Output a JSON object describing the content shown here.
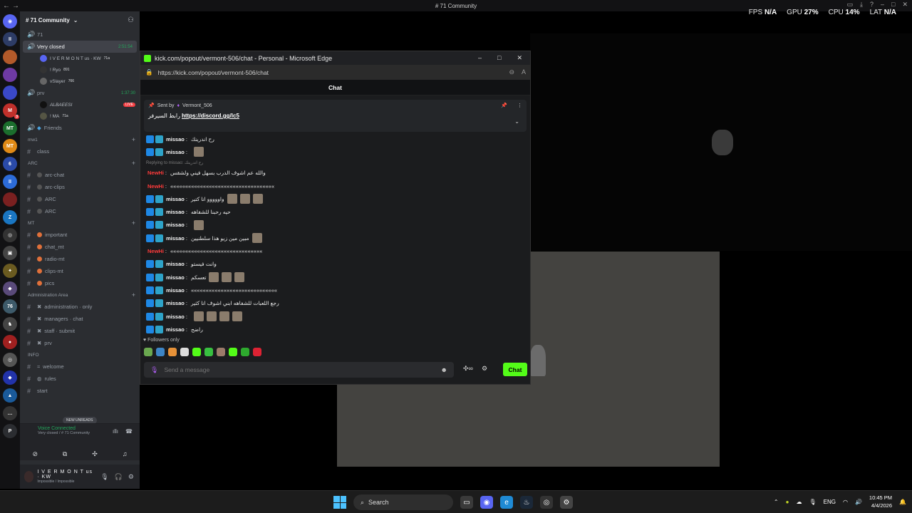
{
  "window": {
    "title": "# 71 Community",
    "nav_icons": "←→"
  },
  "overlay": {
    "fps_label": "FPS",
    "fps_value": "N/A",
    "gpu_label": "GPU",
    "gpu_value": "27%",
    "cpu_label": "CPU",
    "cpu_value": "14%",
    "lat_label": "LAT",
    "lat_value": "N/A"
  },
  "server": {
    "name": "# 71 Community"
  },
  "channels": {
    "top_voice": "71",
    "active": {
      "label": "Very closed",
      "time": "2:51:54"
    },
    "voice_users": [
      {
        "name": "I V E R M O N T us · KW",
        "tag": "71a"
      },
      {
        "name": "! Ryo",
        "tag": "891"
      },
      {
        "name": "vSlayer",
        "tag": "766"
      }
    ],
    "prv": {
      "label": "prv",
      "time": "1:37:30"
    },
    "prv_users": [
      {
        "name": "ALBAEESI",
        "badge": "LIVE"
      },
      {
        "name": "! MA",
        "tag": "71a"
      }
    ],
    "friends": "Friends",
    "cat_mw1": "mw1",
    "class": "class",
    "cat_arc": "ARC",
    "arc_chat": "arc-chat",
    "arc_clips": "arc-clips",
    "arc1": "ARC",
    "arc2": "ARC",
    "cat_mt": "MT",
    "important": "important",
    "chat_mt": "chat_mt",
    "radio_mt": "radio-mt",
    "clips_mt": "clips-mt",
    "pics": "pics",
    "cat_admin": "Administration Area",
    "admin_only": "administration · only",
    "managers_chat": "managers · chat",
    "staff_submit": "staff · submit",
    "prv2": "prv",
    "cat_info": "INFO",
    "welcome": "welcome",
    "rules": "rules",
    "start": "start",
    "new_unreads": "NEW UNREADS"
  },
  "voice_panel": {
    "status": "Voice Connected",
    "sub": "Very closed / # 71 Community"
  },
  "user": {
    "name": "I V E R M O N T us · KW",
    "status": "Impossible / Impossible"
  },
  "edge": {
    "title": "kick.com/popout/vermont-506/chat - Personal - Microsoft Edge",
    "url": "https://kick.com/popout/vermont-506/chat"
  },
  "chat": {
    "header": "Chat",
    "pinned_sent_by": "Sent by",
    "pinned_user": "Vermont_506",
    "pinned_prefix": "رابط السيرفر",
    "pinned_link": "https://discord.gg/lc5",
    "messages": [
      {
        "user": "missao",
        "text": "رح اندرينك",
        "emotes": 0
      },
      {
        "user": "missao",
        "text": "",
        "emotes": 1
      },
      {
        "reply": "Replying to missao: رح اندرينك"
      },
      {
        "user": "NewHi",
        "red": true,
        "text": "والله عم اشوف الدرب بسهل فيني ولشقس",
        "emotes": 0,
        "nobadge": true
      },
      {
        "user": "NewHi",
        "red": true,
        "text": "«««««««««««««««««««««««««««««««««««",
        "emotes": 0,
        "nobadge": true
      },
      {
        "user": "missao",
        "text": "واووووو انا كتير",
        "emotes": 3
      },
      {
        "user": "missao",
        "text": "حيه رحبنا للشفاهه",
        "emotes": 0
      },
      {
        "user": "missao",
        "text": "",
        "emotes": 1
      },
      {
        "user": "missao",
        "text": "مبين مين زيو هذا سلطنيين",
        "emotes": 1
      },
      {
        "user": "NewHi",
        "red": true,
        "text": "«««««««««««««««««««««««««««««««",
        "emotes": 0,
        "nobadge": true
      },
      {
        "user": "missao",
        "text": "وانت فيستو",
        "emotes": 0
      },
      {
        "user": "missao",
        "text": "تعسكم",
        "emotes": 3
      },
      {
        "user": "missao",
        "text": "«««««««««««««««««««««««««««««",
        "emotes": 0
      },
      {
        "user": "missao",
        "text": "رجع اللعبات للشفاهه ابني اشوف انا كثير",
        "emotes": 0
      },
      {
        "user": "missao",
        "text": "",
        "emotes": 4
      },
      {
        "user": "missao",
        "text": "راضح",
        "emotes": 0
      }
    ],
    "followers_only": "Followers only",
    "input_placeholder": "Send a message",
    "send_label": "Chat"
  },
  "taskbar": {
    "search": "Search",
    "lang": "ENG",
    "time": "10:45 PM",
    "date": "4/4/2026"
  },
  "colors": {
    "kick_green": "#53fc18",
    "discord_sidebar": "#2b2d31"
  }
}
